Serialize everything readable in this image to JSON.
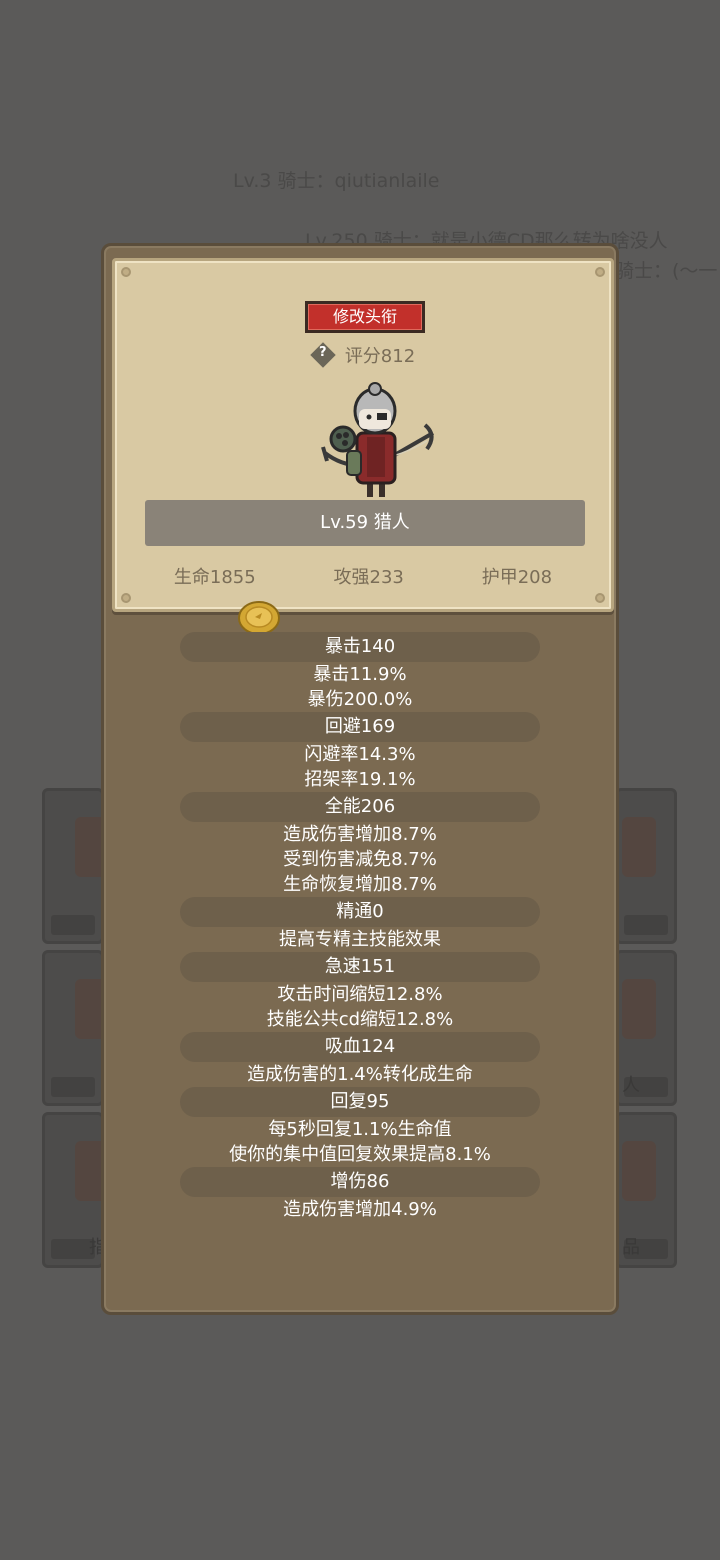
{
  "background_chat": [
    "Lv.3 骑士：qiutianlaile",
    "Lv.250 骑士：就是小德CD那么转为啥没人",
    "骑士：(～一"
  ],
  "background_slots": {
    "left_bottom_label": "指",
    "right_middle_label": "人",
    "right_bottom_label": "品"
  },
  "card": {
    "rename_button": "修改头衔",
    "score_label": "评分812",
    "help_icon": "?",
    "level_label": "Lv.59 猎人",
    "stats": {
      "hp": "生命1855",
      "attack": "攻强233",
      "armor": "护甲208"
    }
  },
  "attributes": [
    {
      "header": "暴击140",
      "lines": [
        "暴击11.9%",
        "暴伤200.0%"
      ]
    },
    {
      "header": "回避169",
      "lines": [
        "闪避率14.3%",
        "招架率19.1%"
      ]
    },
    {
      "header": "全能206",
      "lines": [
        "造成伤害增加8.7%",
        "受到伤害减免8.7%",
        "生命恢复增加8.7%"
      ]
    },
    {
      "header": "精通0",
      "lines": [
        "提高专精主技能效果"
      ]
    },
    {
      "header": "急速151",
      "lines": [
        "攻击时间缩短12.8%",
        "技能公共cd缩短12.8%"
      ]
    },
    {
      "header": "吸血124",
      "lines": [
        "造成伤害的1.4%转化成生命"
      ]
    },
    {
      "header": "回复95",
      "lines": [
        "每5秒回复1.1%生命值",
        "使你的集中值回复效果提高8.1%"
      ]
    },
    {
      "header": "增伤86",
      "lines": [
        "造成伤害增加4.9%"
      ]
    }
  ],
  "colors": {
    "overlay_bg": "#5b5a59",
    "panel_brown": "#7b6a51",
    "parchment": "#d9c9a3",
    "rename_red": "#c2302b"
  }
}
